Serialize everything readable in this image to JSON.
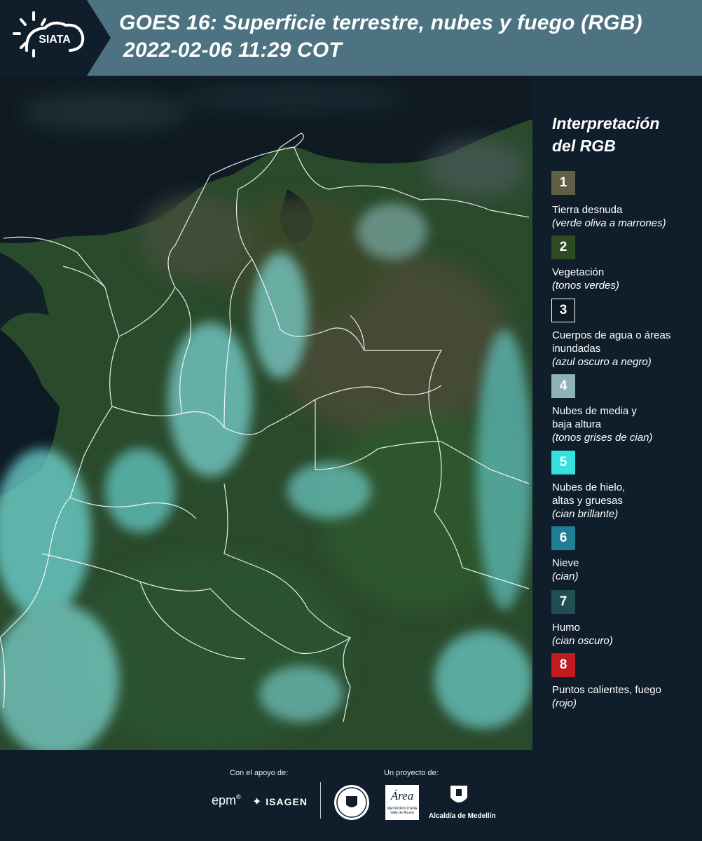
{
  "header": {
    "title_line1": "GOES 16: Superficie terrestre, nubes y fuego (RGB)",
    "title_line2": "2022-02-06 11:29 COT",
    "logo_text": "SIATA"
  },
  "legend": {
    "title_line1": "Interpretación",
    "title_line2": "del RGB",
    "items": [
      {
        "num": "1",
        "name": "Tierra desnuda",
        "desc": "(verde oliva a marrones)",
        "color": "#5e5f45"
      },
      {
        "num": "2",
        "name": "Vegetación",
        "desc": "(tonos verdes)",
        "color": "#2e4a20"
      },
      {
        "num": "3",
        "name": "Cuerpos de agua o áreas inundadas",
        "desc": "(azul oscuro a negro)",
        "color": "#0d1a22"
      },
      {
        "num": "4",
        "name": "Nubes de media y baja altura",
        "desc": "(tonos grises de cian)",
        "color": "#8fb3b6"
      },
      {
        "num": "5",
        "name": "Nubes de hielo, altas y gruesas",
        "desc": "(cian brillante)",
        "color": "#35e0e0"
      },
      {
        "num": "6",
        "name": "Nieve",
        "desc": "(cian)",
        "color": "#1e7e92"
      },
      {
        "num": "7",
        "name": "Humo",
        "desc": "(cian oscuro)",
        "color": "#1f4f52"
      },
      {
        "num": "8",
        "name": "Puntos calientes, fuego",
        "desc": "(rojo)",
        "color": "#c11b20"
      }
    ]
  },
  "footer": {
    "support_label": "Con el apoyo de:",
    "project_label": "Un proyecto de:",
    "epm_text": "epm",
    "isagen_text": "ISAGEN",
    "area_text": "Área",
    "area_sub1": "METROPOLITANA",
    "area_sub2": "Valle de Aburrá",
    "alcaldia_text": "Alcaldía de Medellín"
  }
}
